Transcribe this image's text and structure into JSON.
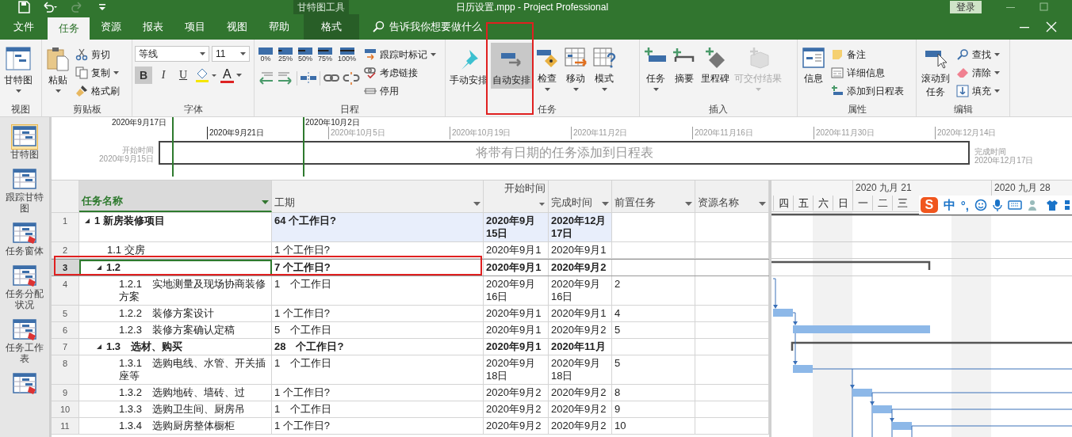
{
  "title_bar": {
    "context_label": "甘特图工具",
    "document_title": "日历设置.mpp  -  Project Professional",
    "sign_in": "登录"
  },
  "tabs": [
    {
      "label": "文件",
      "selected": false,
      "kind": "normal"
    },
    {
      "label": "任务",
      "selected": true,
      "kind": "normal"
    },
    {
      "label": "资源",
      "selected": false,
      "kind": "normal"
    },
    {
      "label": "报表",
      "selected": false,
      "kind": "normal"
    },
    {
      "label": "项目",
      "selected": false,
      "kind": "normal"
    },
    {
      "label": "视图",
      "selected": false,
      "kind": "normal"
    },
    {
      "label": "帮助",
      "selected": false,
      "kind": "normal"
    },
    {
      "label": "格式",
      "selected": false,
      "kind": "context"
    }
  ],
  "tell_me": {
    "placeholder": "告诉我你想要做什么"
  },
  "ribbon": {
    "view": {
      "label": "视图",
      "gantt": "甘特图"
    },
    "clipboard": {
      "label": "剪贴板",
      "paste": "粘贴",
      "cut": "剪切",
      "copy": "复制",
      "format_painter": "格式刷"
    },
    "font": {
      "label": "字体",
      "font_name": "等线",
      "font_size": "11",
      "bold": {
        "label": "B",
        "on": true
      },
      "italic": {
        "label": "I",
        "on": false
      },
      "underline": {
        "label": "U",
        "on": false
      },
      "font_color": "A"
    },
    "schedule": {
      "label": "日程",
      "percents": [
        "0%",
        "25%",
        "50%",
        "75%",
        "100%"
      ],
      "mark_on_track": "跟踪时标记",
      "respect_links": "考虑链接",
      "inactivate": "停用"
    },
    "tasks": {
      "label": "任务",
      "modes": [
        {
          "label": "手动安排",
          "selected": false,
          "kind": "manual"
        },
        {
          "label": "自动安排",
          "selected": true,
          "kind": "auto"
        }
      ],
      "inspect": "检查",
      "move": "移动",
      "mode": "模式"
    },
    "insert": {
      "label": "插入",
      "items": [
        {
          "label": "任务",
          "disabled": false,
          "kind": "task"
        },
        {
          "label": "摘要",
          "disabled": false,
          "kind": "summary"
        },
        {
          "label": "里程碑",
          "disabled": false,
          "kind": "milestone"
        },
        {
          "label": "可交付结果",
          "disabled": true,
          "kind": "deliverable"
        }
      ]
    },
    "properties": {
      "label": "属性",
      "information": "信息",
      "notes": "备注",
      "details": "详细信息",
      "add_to_timeline": "添加到日程表"
    },
    "editing": {
      "label": "编辑",
      "scroll_to_task": "滚动到任务",
      "find": "查找",
      "clear": "清除",
      "fill": "填充"
    }
  },
  "views": [
    {
      "label": "甘特图",
      "selected": true
    },
    {
      "label": "跟踪甘特图",
      "selected": false
    },
    {
      "label": "任务窗体",
      "selected": false
    },
    {
      "label": "任务分配状况",
      "selected": false
    },
    {
      "label": "任务工作表",
      "selected": false
    },
    {
      "selected": false
    }
  ],
  "timeline": {
    "markers": [
      "2020年9月17日",
      "2020年10月2日"
    ],
    "scale": [
      {
        "label": "2020年9月21日",
        "dark": true
      },
      {
        "label": "2020年10月5日",
        "dark": false
      },
      {
        "label": "2020年10月19日",
        "dark": false
      },
      {
        "label": "2020年11月2日",
        "dark": false
      },
      {
        "label": "2020年11月16日",
        "dark": false
      },
      {
        "label": "2020年11月30日",
        "dark": false
      },
      {
        "label": "2020年12月14日",
        "dark": false
      }
    ],
    "start_label": "开始时间",
    "start_date": "2020年9月15日",
    "placeholder": "将带有日期的任务添加到日程表",
    "finish_label": "完成时间",
    "finish_date": "2020年12月17日"
  },
  "table": {
    "columns": [
      {
        "label": "任务名称",
        "selected": true
      },
      {
        "label": "工期",
        "selected": false
      },
      {
        "label": "开始时间",
        "selected": false
      },
      {
        "label": "完成时间",
        "selected": false
      },
      {
        "label": "前置任务",
        "selected": false
      },
      {
        "label": "资源名称",
        "selected": false
      }
    ],
    "rows": [
      {
        "number": "1",
        "name": "1 新房装修项目",
        "duration": "64 个工作日?",
        "start": "2020年9月15日",
        "finish": "2020年12月17日",
        "summary": true,
        "expanded": true,
        "selected": false,
        "highlighted": true,
        "children": [
          {
            "number": "2",
            "name": "1.1 交房",
            "duration": "1 个工作日?",
            "start": "2020年9月1",
            "finish": "2020年9月1",
            "summary": false,
            "selected": false,
            "highlighted": false
          },
          {
            "number": "3",
            "name": "1.2",
            "duration": "7 个工作日?",
            "start": "2020年9月1",
            "finish": "2020年9月2",
            "summary": true,
            "expanded": true,
            "selected": true,
            "highlighted": false,
            "children": [
              {
                "number": "4",
                "name": "1.2.1　实地测量及现场协商装修方案",
                "duration": "1　个工作日",
                "start": "2020年9月16日",
                "finish": "2020年9月16日",
                "predecessors": "2",
                "summary": false,
                "selected": false,
                "highlighted": false
              },
              {
                "number": "5",
                "name": "1.2.2　装修方案设计",
                "duration": "1 个工作日?",
                "start": "2020年9月1",
                "finish": "2020年9月1",
                "predecessors": "4",
                "summary": false,
                "selected": false,
                "highlighted": false
              },
              {
                "number": "6",
                "name": "1.2.3　装修方案确认定稿",
                "duration": "5　个工作日",
                "start": "2020年9月1",
                "finish": "2020年9月2",
                "predecessors": "5",
                "summary": false,
                "selected": false,
                "highlighted": false
              }
            ]
          },
          {
            "number": "7",
            "name": "1.3　选材、购买",
            "duration": "28　个工作日?",
            "start": "2020年9月1",
            "finish": "2020年11月",
            "summary": true,
            "expanded": true,
            "selected": false,
            "highlighted": false,
            "children": [
              {
                "number": "8",
                "name": "1.3.1　选购电线、水管、开关插座等",
                "duration": "1　个工作日",
                "start": "2020年9月18日",
                "finish": "2020年9月18日",
                "predecessors": "5",
                "summary": false,
                "selected": false,
                "highlighted": false
              },
              {
                "number": "9",
                "name": "1.3.2　选购地砖、墙砖、过",
                "duration": "1 个工作日?",
                "start": "2020年9月2",
                "finish": "2020年9月2",
                "predecessors": "8",
                "summary": false,
                "selected": false,
                "highlighted": false
              },
              {
                "number": "10",
                "name": "1.3.3　选购卫生间、厨房吊",
                "duration": "1　个工作日",
                "start": "2020年9月2",
                "finish": "2020年9月2",
                "predecessors": "9",
                "summary": false,
                "selected": false,
                "highlighted": false
              },
              {
                "number": "11",
                "name": "1.3.4　选购厨房整体橱柜",
                "duration": "1 个工作日?",
                "start": "2020年9月2",
                "finish": "2020年9月2",
                "predecessors": "10",
                "summary": false,
                "selected": false,
                "highlighted": false
              }
            ]
          }
        ]
      }
    ]
  },
  "gantt": {
    "weeks": [
      "2020 九月 21",
      "2020 九月 28"
    ],
    "days": [
      "四",
      "五",
      "六",
      "日",
      "一",
      "二",
      "三"
    ]
  },
  "ime_toolbar": {
    "logo": "S",
    "mode": "中",
    "punctuation": "°,"
  }
}
